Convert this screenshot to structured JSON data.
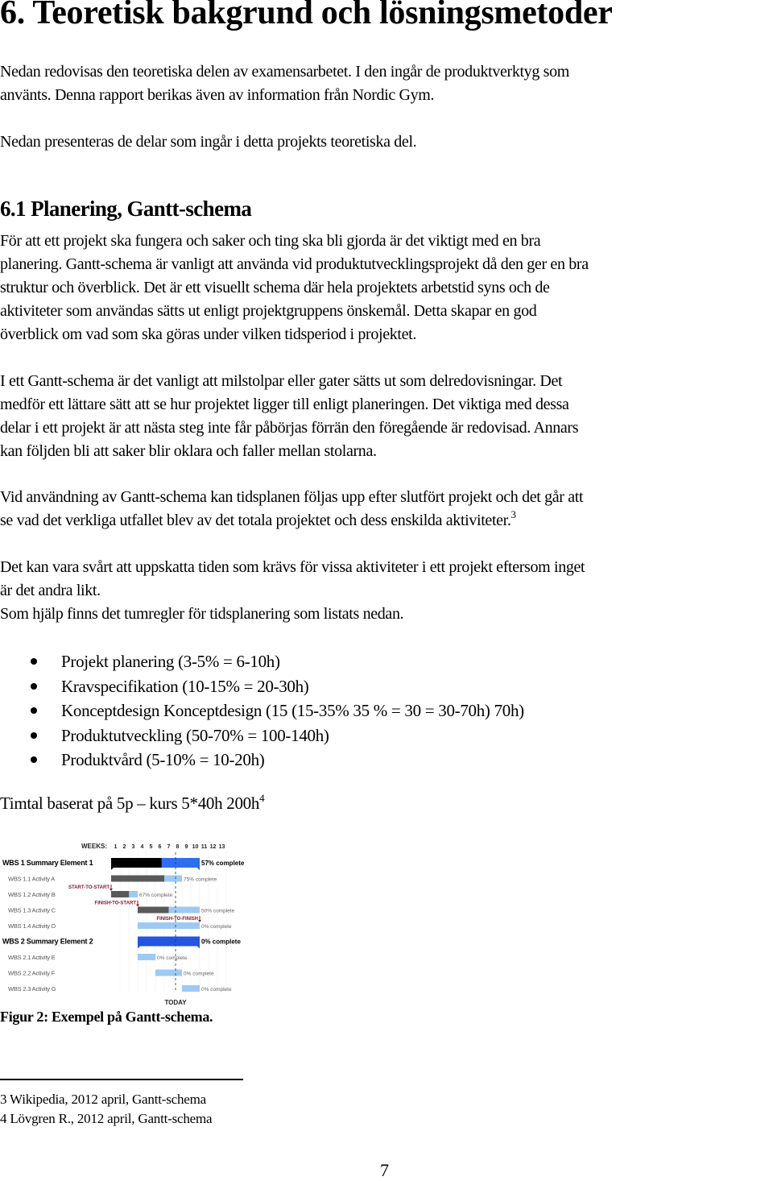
{
  "heading": "6. Teoretisk bakgrund och lösningsmetoder",
  "intro": {
    "lines": [
      "Nedan redovisas den teoretiska delen av examensarbetet. I den ingår de produktverktyg som",
      "använts. Denna rapport berikas även av information från Nordic Gym."
    ],
    "line2": "Nedan presenteras de delar som ingår i detta projekts teoretiska del."
  },
  "section": {
    "title": "6.1 Planering, Gantt-schema",
    "para1": [
      "För att ett projekt ska fungera och saker och ting ska bli gjorda är det viktigt med en bra",
      "planering. Gantt-schema är vanligt att använda vid produktutvecklingsprojekt då den ger en bra",
      "struktur och överblick. Det är ett visuellt schema där hela projektets arbetstid syns och de",
      "aktiviteter som användas sätts ut enligt projektgruppens önskemål. Detta skapar en god",
      "överblick om vad som ska göras under vilken tidsperiod i projektet."
    ],
    "para2": [
      "I ett Gantt-schema är det vanligt att milstolpar eller gater sätts ut som delredovisningar. Det",
      "medför ett lättare sätt att se hur projektet ligger till enligt planeringen. Det viktiga med dessa",
      "delar i ett projekt är att nästa steg inte får påbörjas förrän den föregående är redovisad. Annars",
      "kan följden bli att saker blir oklara och faller mellan stolarna."
    ],
    "para3": [
      "Vid användning av Gantt-schema kan tidsplanen följas upp efter slutfört projekt och det går att",
      "se vad det verkliga utfallet blev av det totala projektet och dess enskilda aktiviteter."
    ],
    "para3_footnote_ref": "3",
    "para4": [
      "Det kan vara svårt att uppskatta tiden som krävs för vissa aktiviteter i ett projekt eftersom inget",
      "är det andra likt.",
      "Som hjälp finns det tumregler för tidsplanering som listats nedan."
    ],
    "bullets": [
      "Projekt planering (3-5% = 6-10h)",
      "Kravspecifikation (10-15% = 20-30h)",
      "Konceptdesign Konceptdesign (15 (15-35% 35 % = 30 = 30-70h) 70h)",
      "Produktutveckling (50-70% = 100-140h)",
      "Produktvård (5-10% = 10-20h)"
    ],
    "timtal": "Timtal baserat på 5p – kurs 5*40h 200h",
    "timtal_footnote_ref": "4"
  },
  "figure": {
    "caption": "Figur 2: Exempel på Gantt-schema."
  },
  "footnotes": [
    "3 Wikipedia, 2012 april, Gantt-schema",
    "4 Lövgren R., 2012 april, Gantt-schema"
  ],
  "page_number": "7",
  "chart_data": {
    "type": "gantt",
    "title": "",
    "xlabel": "WEEKS:",
    "weeks": [
      1,
      2,
      3,
      4,
      5,
      6,
      7,
      8,
      9,
      10,
      11,
      12,
      13
    ],
    "today_week": 8,
    "today_label": "TODAY",
    "colors": {
      "summary_done": "#000000",
      "summary_remaining": "#2f6ef0",
      "summary_empty": "#2355e0",
      "task_done": "#595959",
      "task_remaining": "#9ccaf5",
      "dependency": "#8b1a2b",
      "label_gray": "#555555"
    },
    "tasks": [
      {
        "label": "WBS 1 Summary Element 1",
        "summary": true,
        "start": 1,
        "end": 10,
        "percent": 57,
        "status": "57% complete"
      },
      {
        "label": "WBS 1.1 Activity A",
        "summary": false,
        "start": 1,
        "end": 8,
        "percent": 75,
        "status": "75% complete"
      },
      {
        "label": "WBS 1.2 Activity B",
        "summary": false,
        "start": 1,
        "end": 3,
        "percent": 67,
        "status": "67% complete"
      },
      {
        "label": "WBS 1.3 Activity C",
        "summary": false,
        "start": 4,
        "end": 10,
        "percent": 50,
        "status": "50% complete"
      },
      {
        "label": "WBS 1.4 Activity D",
        "summary": false,
        "start": 4,
        "end": 10,
        "percent": 0,
        "status": "0% complete"
      },
      {
        "label": "WBS 2 Summary Element 2",
        "summary": true,
        "start": 4,
        "end": 10,
        "percent": 0,
        "status": "0% complete"
      },
      {
        "label": "WBS 2.1 Activity E",
        "summary": false,
        "start": 4,
        "end": 5,
        "percent": 0,
        "status": "0% complete"
      },
      {
        "label": "WBS 2.2 Activity F",
        "summary": false,
        "start": 6,
        "end": 8,
        "percent": 0,
        "status": "0% complete"
      },
      {
        "label": "WBS 2.3 Activity G",
        "summary": false,
        "start": 9,
        "end": 10,
        "percent": 0,
        "status": "0% complete"
      }
    ],
    "dependencies": [
      {
        "label": "START-TO-START",
        "from_task": 1,
        "to_task": 2,
        "at_week_start": 1
      },
      {
        "label": "FINISH-TO-START",
        "from_task": 2,
        "to_task": 3,
        "at_week_start": 4
      },
      {
        "label": "FINISH-TO-FINISH",
        "from_task": 3,
        "to_task": 4,
        "at_week_end": 10
      }
    ]
  }
}
